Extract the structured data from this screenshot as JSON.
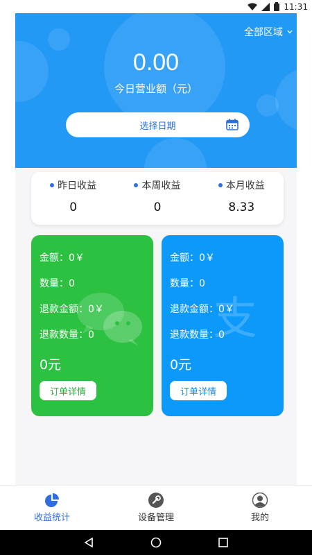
{
  "status_bar": {
    "time": "11:31"
  },
  "hero": {
    "region": "全部区域",
    "today_amount": "0.00",
    "today_label": "今日营业额（元）",
    "date_button": "选择日期"
  },
  "summary": [
    {
      "label": "昨日收益",
      "value": "0"
    },
    {
      "label": "本周收益",
      "value": "0"
    },
    {
      "label": "本月收益",
      "value": "8.33"
    }
  ],
  "wechat_card": {
    "amount": "金额：0￥",
    "count": "数量：0",
    "refund_amount": "退款金额：0￥",
    "refund_count": "退款数量：0",
    "total": "0元",
    "detail_button": "订单详情"
  },
  "alipay_card": {
    "amount": "金额：0￥",
    "count": "数量：0",
    "refund_amount": "退款金额：0￥",
    "refund_count": "退款数量：0",
    "total": "0元",
    "detail_button": "订单详情"
  },
  "bottom_nav": [
    {
      "label": "收益统计",
      "icon": "pie-chart-icon",
      "active": true
    },
    {
      "label": "设备管理",
      "icon": "wrench-icon",
      "active": false
    },
    {
      "label": "我的",
      "icon": "user-icon",
      "active": false
    }
  ],
  "colors": {
    "hero_bg": "#2299f5",
    "wechat_green": "#2dc142",
    "alipay_blue": "#0d99fa",
    "accent": "#2f6de1"
  }
}
